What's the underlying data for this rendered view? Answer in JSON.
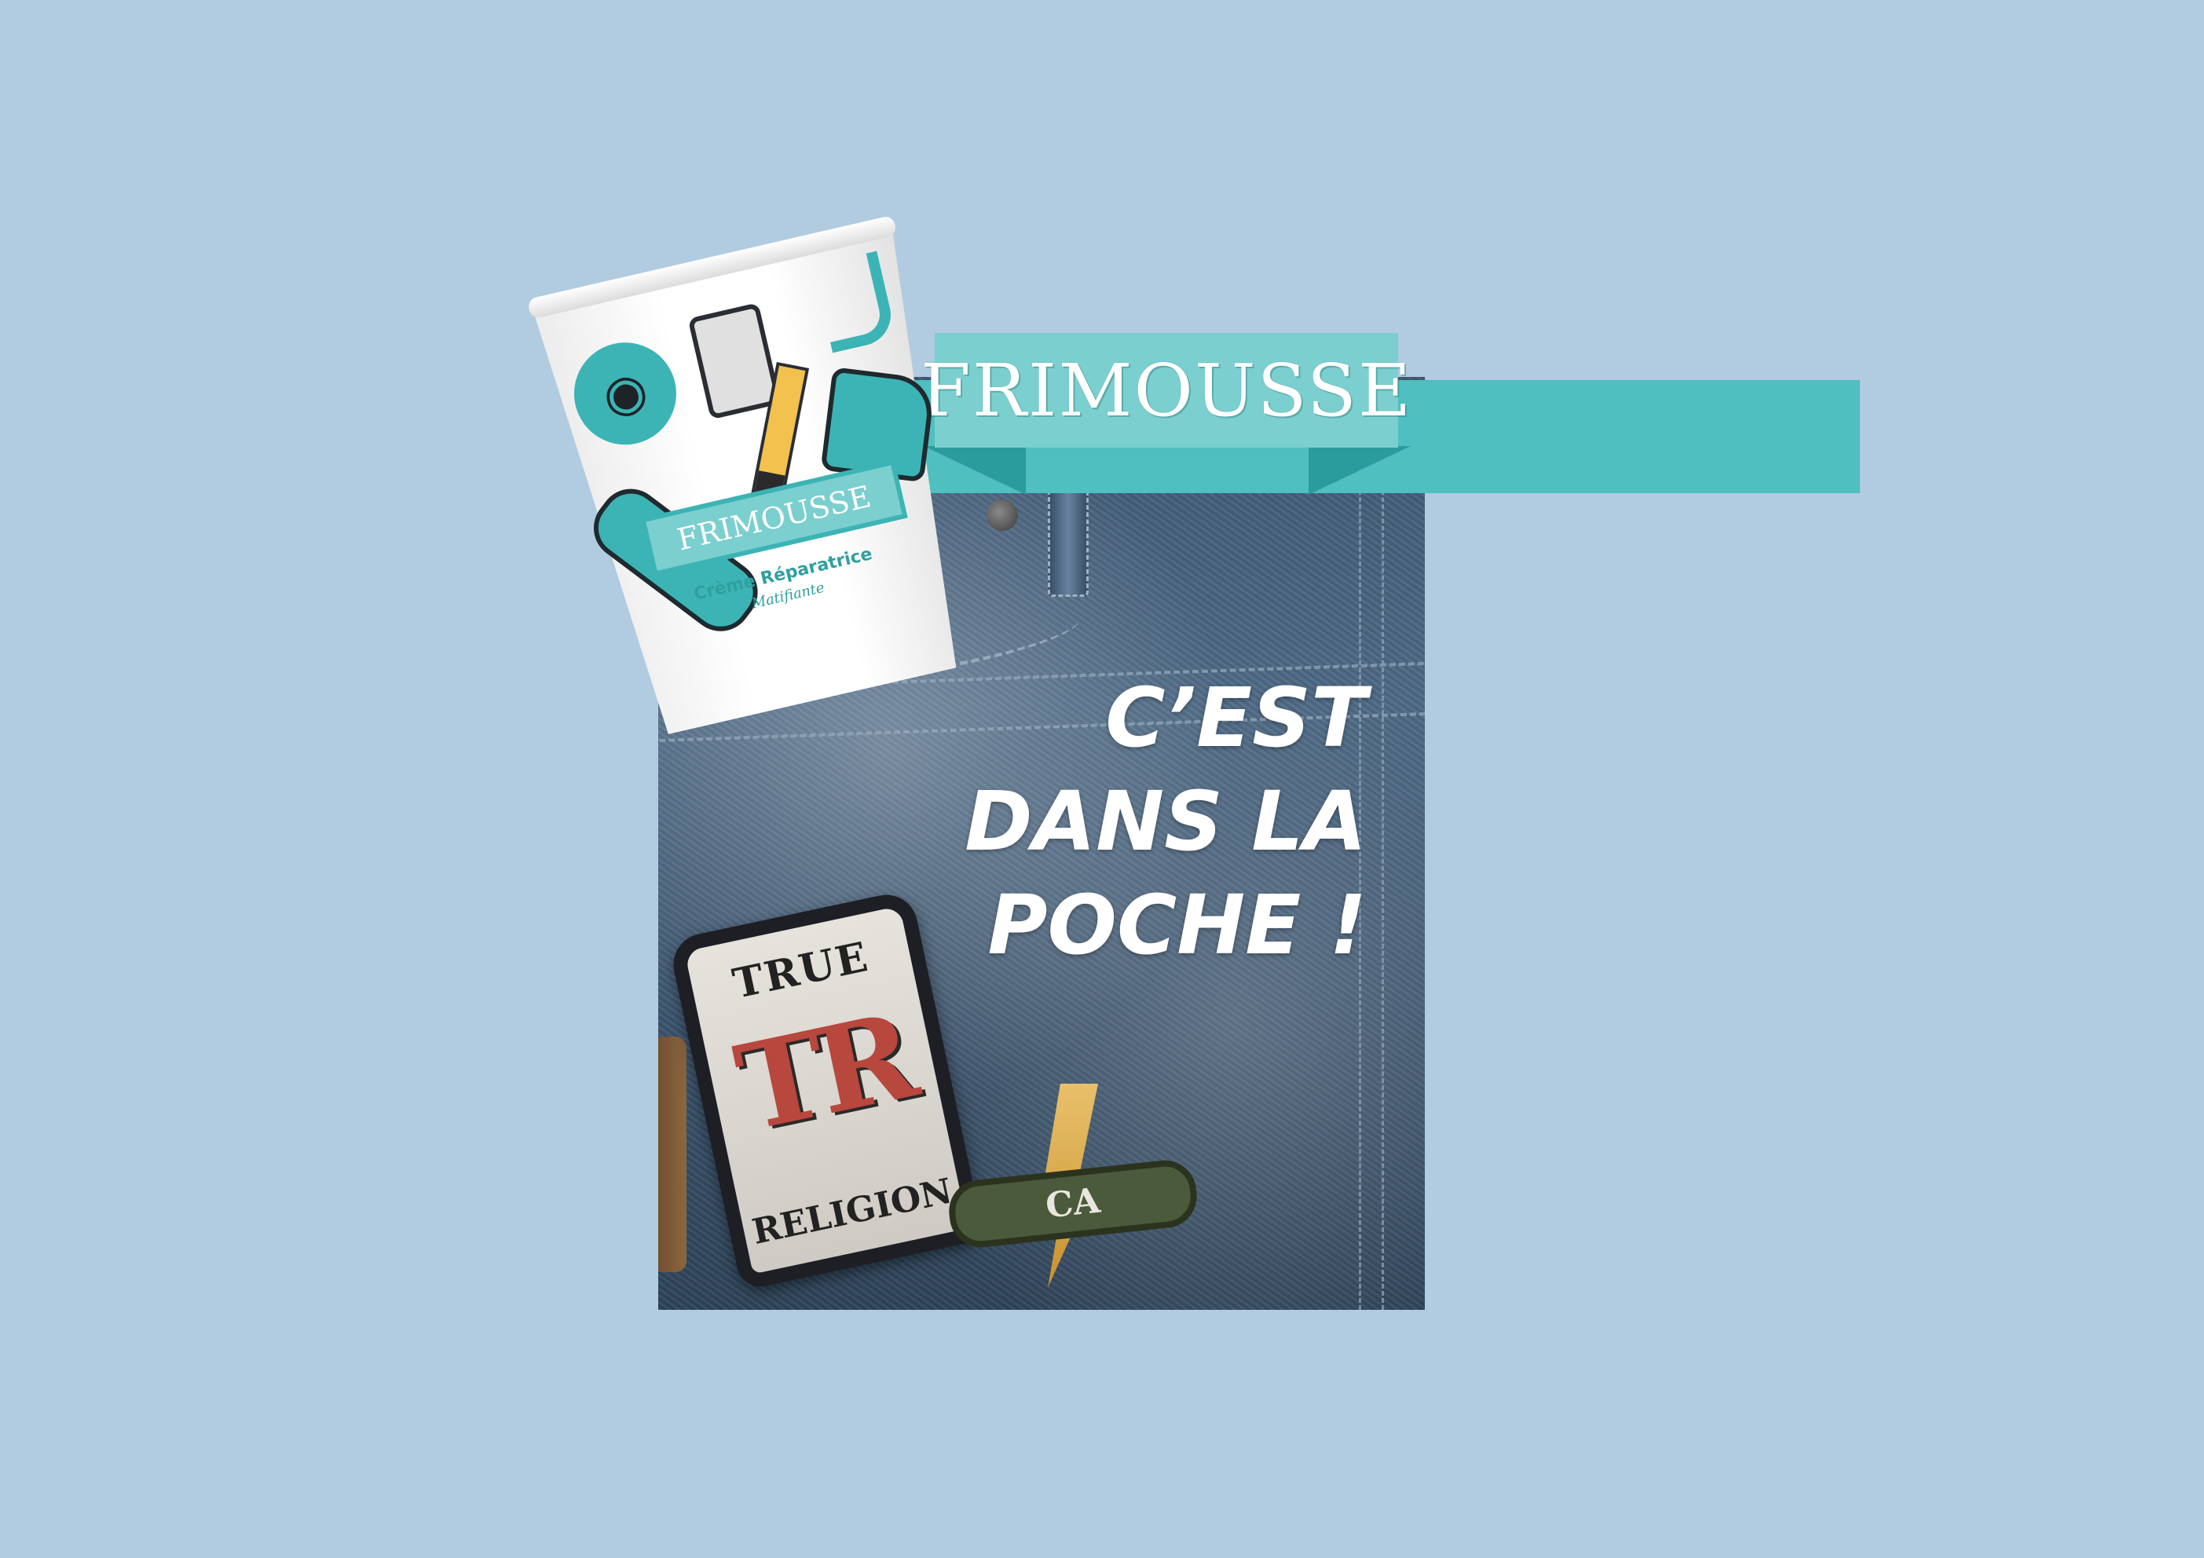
{
  "brand": {
    "name": "FRIMOUSSE",
    "color_teal": "#4fbfc0",
    "color_teal_light": "#7ccfcf",
    "color_teal_dark": "#2b9c9e",
    "background": "#b1cce0"
  },
  "tagline": {
    "line1": "C’EST",
    "line2": "DANS LA",
    "line3": "POCHE !"
  },
  "product": {
    "brand": "FRIMOUSSE",
    "name": "Crème Réparatrice",
    "variant": "Matifiante",
    "icons": [
      "camera-icon",
      "phone-icon",
      "pencil-icon",
      "skateboard-icon",
      "sneaker-icon",
      "hook-icon"
    ]
  },
  "patches": {
    "tr_top": "TRUE",
    "tr_mono": "TR",
    "tr_bottom": "RELIGION",
    "ca_label": "CA"
  }
}
